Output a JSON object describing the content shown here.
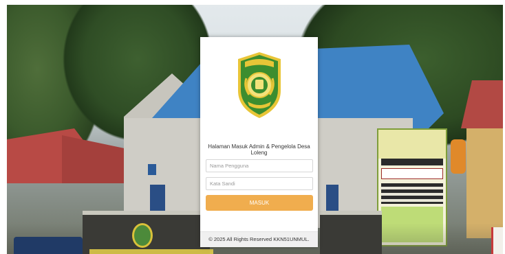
{
  "login": {
    "title": "Halaman Masuk Admin & Pengelola Desa Loleng",
    "username_placeholder": "Nama Pengguna",
    "username_value": "",
    "password_placeholder": "Kata Sandi",
    "password_value": "",
    "submit_label": "MASUK",
    "footer": "© 2025 All Rights Reserved KKN51UNMUL."
  },
  "logo": {
    "icon": "kabupaten-kutai-kartanegara-emblem",
    "colors": {
      "shield": "#3c8d2f",
      "border": "#e8c537",
      "inner": "#f3e27a"
    }
  },
  "background": {
    "billboard_heading": "APBDes 2018",
    "billboard_amount": "1.887.115.298,-"
  },
  "colors": {
    "button": "#f0ad4e",
    "card": "#ffffff",
    "footer_bg": "#f0f0f0"
  }
}
